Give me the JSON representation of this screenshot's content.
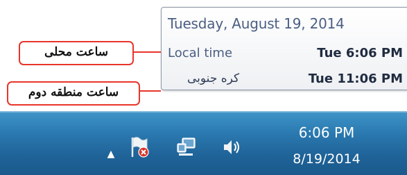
{
  "tooltip": {
    "date": "Tuesday, August 19, 2014",
    "rows": [
      {
        "label": "Local time",
        "time": "Tue 6:06 PM"
      },
      {
        "label": "کره جنوبی",
        "time": "Tue 11:06 PM"
      }
    ]
  },
  "callouts": {
    "local": "ساعت محلی",
    "second_zone": "ساعت منطقه دوم"
  },
  "taskbar": {
    "clock_time": "6:06 PM",
    "clock_date": "8/19/2014",
    "icons": [
      "show-hidden-icons-chevron",
      "action-center-flag-icon",
      "network-icon",
      "volume-icon"
    ]
  },
  "colors": {
    "callout_border": "#e8352a",
    "taskbar_blue": "#2a79b0",
    "tooltip_text": "#4b5e83"
  }
}
